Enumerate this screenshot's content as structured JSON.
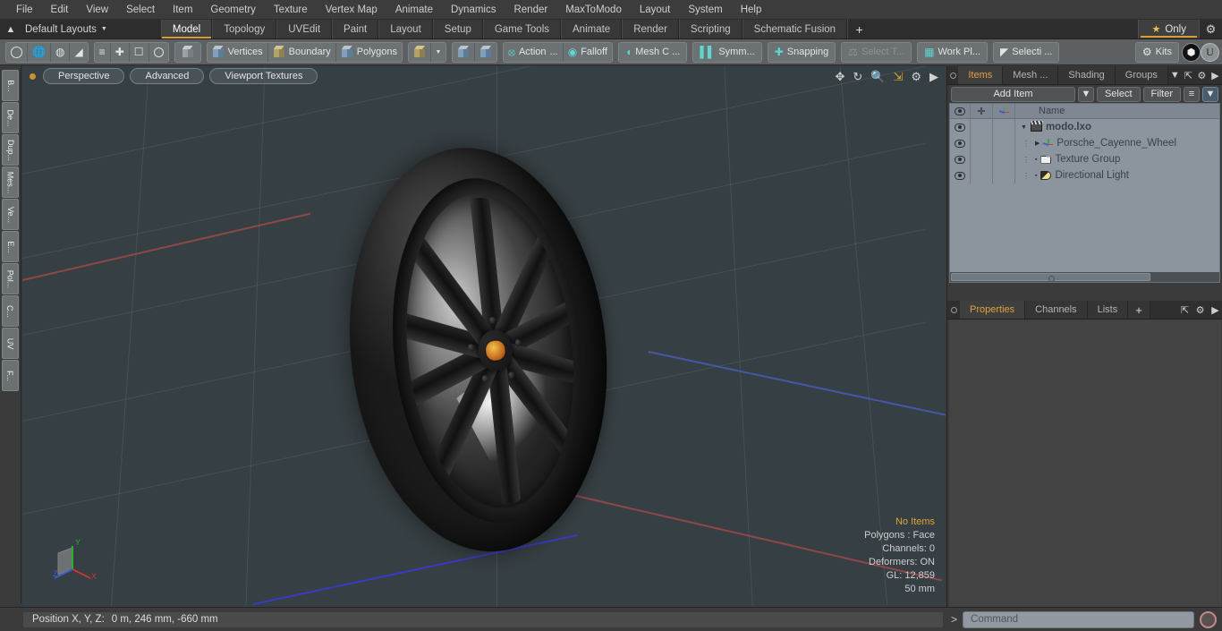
{
  "menu": {
    "items": [
      "File",
      "Edit",
      "View",
      "Select",
      "Item",
      "Geometry",
      "Texture",
      "Vertex Map",
      "Animate",
      "Dynamics",
      "Render",
      "MaxToModo",
      "Layout",
      "System",
      "Help"
    ]
  },
  "layout_bar": {
    "home_icon": "home-icon",
    "layouts_label": "Default Layouts",
    "tabs": [
      {
        "label": "Model",
        "active": true
      },
      {
        "label": "Topology",
        "active": false
      },
      {
        "label": "UVEdit",
        "active": false
      },
      {
        "label": "Paint",
        "active": false
      },
      {
        "label": "Layout",
        "active": false
      },
      {
        "label": "Setup",
        "active": false
      },
      {
        "label": "Game Tools",
        "active": false
      },
      {
        "label": "Animate",
        "active": false
      },
      {
        "label": "Render",
        "active": false
      },
      {
        "label": "Scripting",
        "active": false
      },
      {
        "label": "Schematic Fusion",
        "active": false
      }
    ],
    "add_tab": "+",
    "only_label": "Only",
    "gear_icon": "gear-icon",
    "accent_color": "#d89a33"
  },
  "toolbar": {
    "primitives": [
      "circle-icon",
      "globe-icon",
      "pen-icon",
      "curve-icon"
    ],
    "tools": [
      "stack-icon",
      "align-icon",
      "box-select-icon",
      "ellipse-icon"
    ],
    "selection_mode_icon": "cube-icon",
    "modes": [
      {
        "label": "Vertices",
        "icon": "vertices-cube-icon"
      },
      {
        "label": "Boundary",
        "icon": "boundary-icon"
      },
      {
        "label": "Polygons",
        "icon": "polygons-cube-icon"
      }
    ],
    "center_icon": "gold-cube-icon",
    "dropdown_caret": "chevron-down-icon",
    "xfm_icons": [
      "move-cube-icon",
      "rotate-cube-icon"
    ],
    "action_label": "Action",
    "action_ellipsis": "...",
    "falloff_label": "Falloff",
    "mesh_constraint_label": "Mesh C ...",
    "symmetry_label": "Symm...",
    "snapping_label": "Snapping",
    "select_through_label": "Select T...",
    "work_plane_label": "Work Pl...",
    "selection_label": "Selecti ...",
    "kits_label": "Kits",
    "round_icons": [
      "modo-icon",
      "unreal-icon"
    ]
  },
  "vertical_tabs": [
    "B...",
    "De...",
    "Dup...",
    "Mes...",
    "Ve...",
    "E...",
    "Pol...",
    "C...",
    "UV",
    "F..."
  ],
  "viewport": {
    "dot_color": "#c9912f",
    "buttons": [
      "Perspective",
      "Advanced",
      "Viewport Textures"
    ],
    "tool_icons": [
      "move-icon",
      "rotate-icon",
      "zoom-icon",
      "fit-icon",
      "gear-icon",
      "play-icon"
    ],
    "background_color": "#363f43",
    "axis_gizmo": {
      "x": "X",
      "y": "Y",
      "z": "Z",
      "x_color": "#cc3333",
      "y_color": "#2fae2f",
      "z_color": "#3a5ed0"
    },
    "stats": [
      {
        "text": "No Items",
        "highlight": true
      },
      {
        "text": "Polygons : Face",
        "highlight": false
      },
      {
        "text": "Channels: 0",
        "highlight": false
      },
      {
        "text": "Deformers: ON",
        "highlight": false
      },
      {
        "text": "GL: 12,859",
        "highlight": false
      },
      {
        "text": "50 mm",
        "highlight": false
      }
    ]
  },
  "right_panel": {
    "top_tabs": [
      {
        "label": "Items",
        "active": true
      },
      {
        "label": "Mesh ...",
        "active": false
      },
      {
        "label": "Shading",
        "active": false
      },
      {
        "label": "Groups",
        "active": false
      }
    ],
    "top_tab_icons": [
      "chevron-down-icon",
      "expand-icon",
      "gear-icon",
      "play-icon"
    ],
    "add_item_label": "Add Item",
    "add_item_caret": "chevron-down-icon",
    "select_label": "Select",
    "filter_label": "Filter",
    "list_icon": "list-icon",
    "filter_icon": "funnel-icon",
    "list_header": {
      "visibility": "eye-icon",
      "lock": "plus-icon",
      "axis": "axis-icon",
      "name": "Name"
    },
    "items": [
      {
        "name": "modo.lxo",
        "icon": "clapperboard-icon",
        "depth": 0,
        "expanded": true,
        "bold": true
      },
      {
        "name": "Porsche_Cayenne_Wheel",
        "icon": "axis-icon",
        "depth": 1,
        "expanded": false,
        "bold": false
      },
      {
        "name": "Texture Group",
        "icon": "folder-icon",
        "depth": 1,
        "expanded": false,
        "bold": false
      },
      {
        "name": "Directional Light",
        "icon": "light-icon",
        "depth": 1,
        "expanded": false,
        "bold": false
      }
    ],
    "bottom_tabs": [
      {
        "label": "Properties",
        "active": true
      },
      {
        "label": "Channels",
        "active": false
      },
      {
        "label": "Lists",
        "active": false
      },
      {
        "label": "+",
        "active": false
      }
    ],
    "bottom_tab_icons": [
      "expand-icon",
      "gear-icon",
      "play-icon"
    ],
    "accent_color": "#e0a23c"
  },
  "status_bar": {
    "position_label": "Position X, Y, Z:",
    "position_value": "0 m, 246 mm, -660 mm",
    "command_prompt": ">",
    "command_placeholder": "Command",
    "command_value": "",
    "record_icon": "record-icon"
  }
}
